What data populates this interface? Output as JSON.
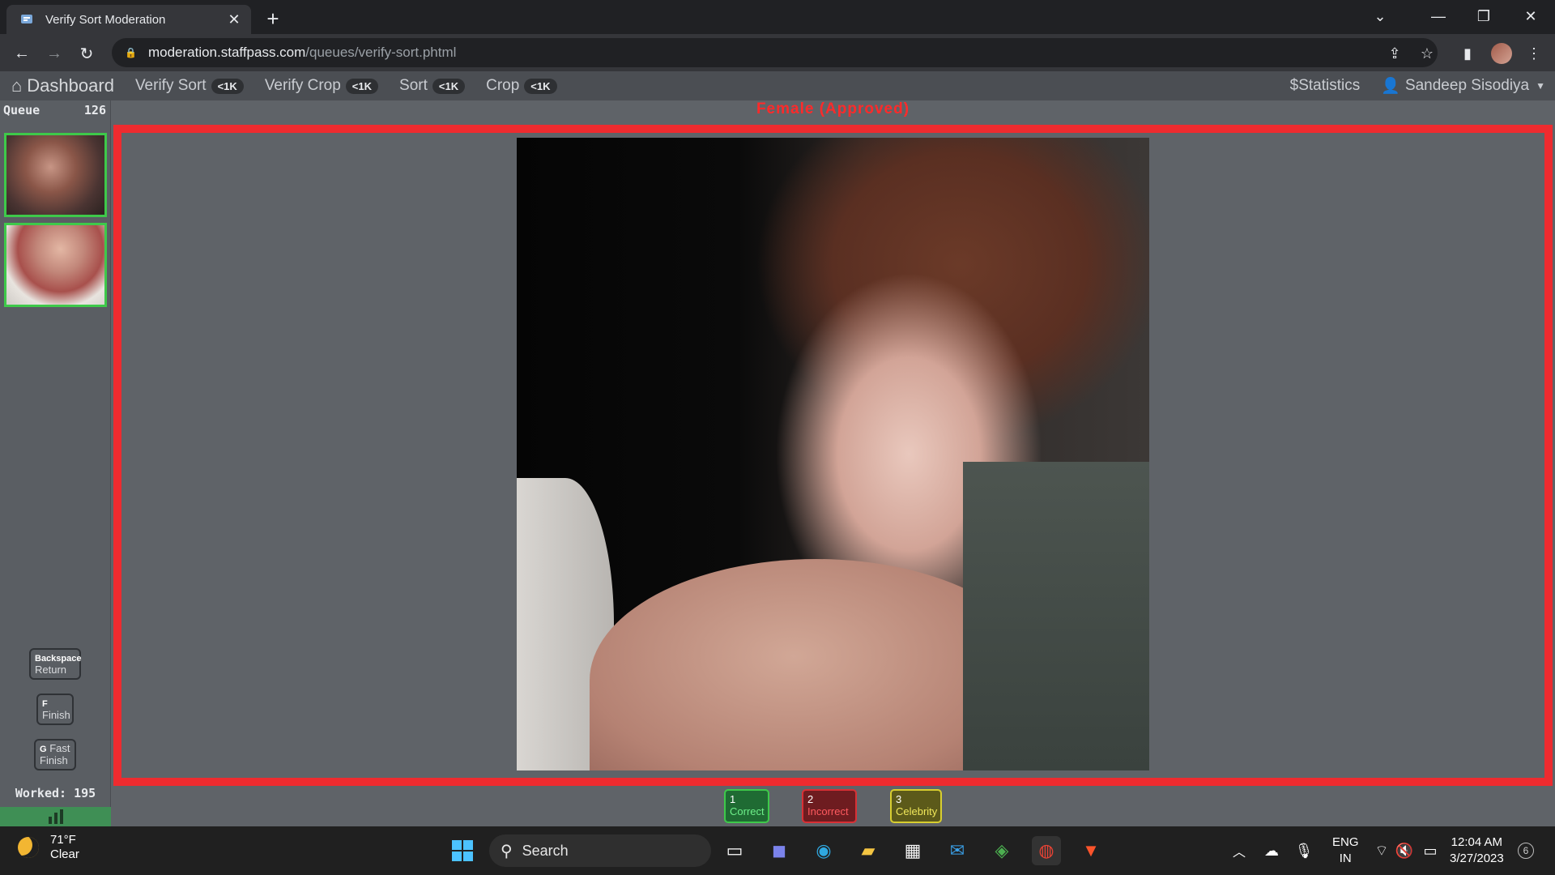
{
  "browser": {
    "tab_title": "Verify Sort Moderation",
    "url_host": "moderation.staffpass.com",
    "url_path": "/queues/verify-sort.phtml"
  },
  "nav": {
    "brand": "Dashboard",
    "items": [
      {
        "label": "Verify Sort",
        "badge": "<1K"
      },
      {
        "label": "Verify Crop",
        "badge": "<1K"
      },
      {
        "label": "Sort",
        "badge": "<1K"
      },
      {
        "label": "Crop",
        "badge": "<1K"
      }
    ],
    "statistics": "Statistics",
    "user": "Sandeep Sisodiya"
  },
  "sidebar": {
    "queue_label": "Queue",
    "queue_count": "126",
    "keys": [
      {
        "key": "Backspace",
        "action": "Return"
      },
      {
        "key": "F",
        "action": "Finish"
      },
      {
        "key": "G",
        "action": "Fast Finish"
      }
    ],
    "worked": "Worked: 195"
  },
  "main": {
    "status_label": "Female (Approved)"
  },
  "rating": {
    "correct": {
      "key": "1",
      "label": "Correct"
    },
    "incorrect": {
      "key": "2",
      "label": "Incorrect"
    },
    "celebrity": {
      "key": "3",
      "label": "Celebrity"
    }
  },
  "taskbar": {
    "temp": "71°F",
    "condition": "Clear",
    "search": "Search",
    "lang1": "ENG",
    "lang2": "IN",
    "time": "12:04 AM",
    "date": "3/27/2023",
    "notif_count": "6"
  },
  "colors": {
    "frame_border": "#ee2b2f",
    "status_text": "#ff2a2a",
    "thumb_border": "#3ec94a"
  }
}
